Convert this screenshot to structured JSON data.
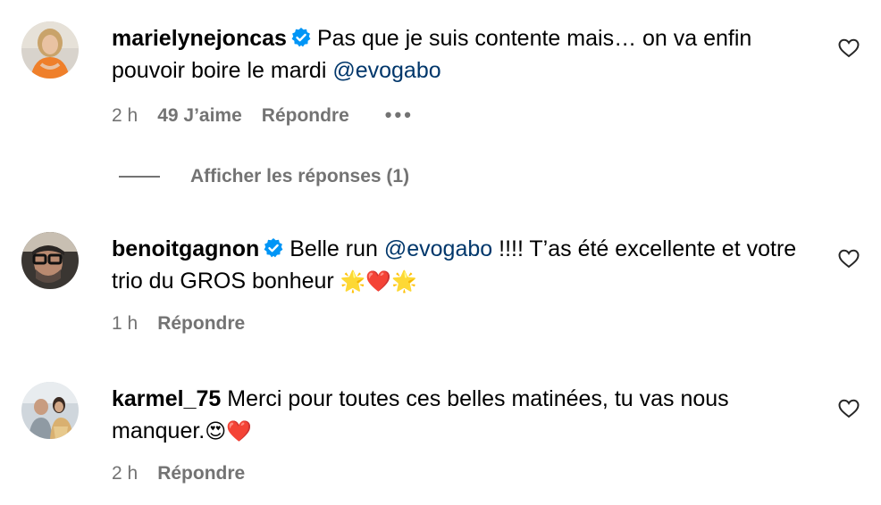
{
  "comments": [
    {
      "username": "marielynejoncas",
      "verified": true,
      "text_before": "Pas que je suis contente mais… on va enfin pouvoir boire le mardi ",
      "mention": "@evogabo",
      "text_after": "",
      "time": "2 h",
      "likes": "49 J’aime",
      "reply_label": "Répondre",
      "more": "•••",
      "avatar_icon": "avatar-woman-orange"
    },
    {
      "username": "benoitgagnon",
      "verified": true,
      "text_before": "Belle run ",
      "mention": "@evogabo",
      "text_after": " !!!! T’as été excellente et votre trio du GROS bonheur ",
      "emoji": "🌟❤️🌟",
      "time": "1 h",
      "reply_label": "Répondre",
      "avatar_icon": "avatar-man-glasses"
    },
    {
      "username": "karmel_75",
      "verified": false,
      "text_before": "Merci pour toutes ces belles matinées, tu vas nous manquer.",
      "emoji": "😍❤️",
      "time": "2 h",
      "reply_label": "Répondre",
      "avatar_icon": "avatar-couple"
    }
  ],
  "view_replies_label": "Afficher les réponses (1)",
  "colors": {
    "text": "#000000",
    "secondary": "#737373",
    "mention": "#00376b",
    "verified": "#0095f6"
  },
  "icons": {
    "verified": "verified-badge-icon",
    "like": "heart-outline-icon"
  }
}
